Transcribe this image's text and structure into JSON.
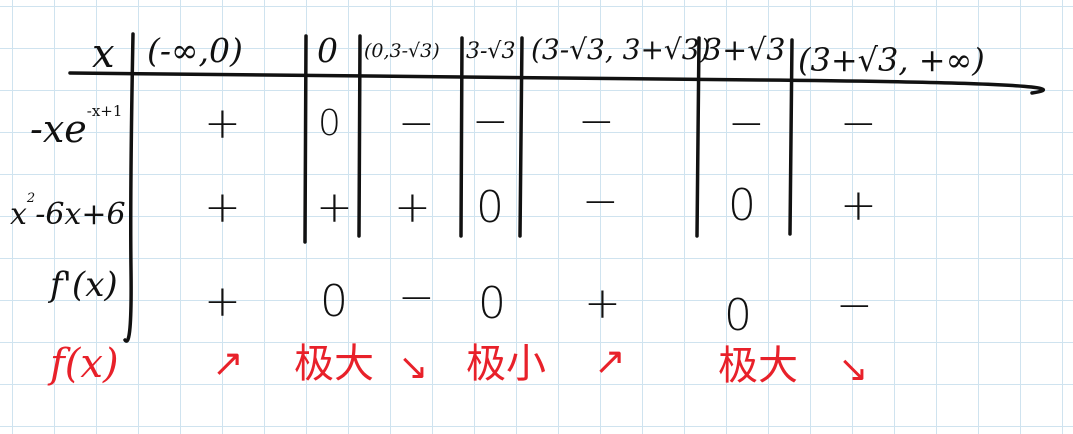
{
  "table": {
    "header": {
      "var": "x",
      "intervals": [
        "(-∞,0)",
        "0",
        "(0,3-√3)",
        "3-√3",
        "(3-√3, 3+√3)",
        "3+√3",
        "(3+√3, +∞)"
      ]
    },
    "rows": [
      {
        "label": "-xe",
        "label_sup": "-x+1",
        "cells": [
          "+",
          "0",
          "−",
          "−",
          "−",
          "−",
          "−"
        ]
      },
      {
        "label": "x",
        "label_sup": "2",
        "label_tail": "-6x+6",
        "cells": [
          "+",
          "+",
          "+",
          "0",
          "−",
          "0",
          "+"
        ]
      },
      {
        "label": "f'(x)",
        "cells": [
          "+",
          "0",
          "−",
          "0",
          "+",
          "0",
          "−"
        ]
      }
    ],
    "behavior": {
      "label": "f(x)",
      "cells": [
        "↗",
        "极大",
        "↘",
        "极小",
        "↗",
        "极大",
        "↘"
      ]
    }
  },
  "colors": {
    "ink": "#111111",
    "red_ink": "#e8212a",
    "grid": "#cfe3ef"
  }
}
